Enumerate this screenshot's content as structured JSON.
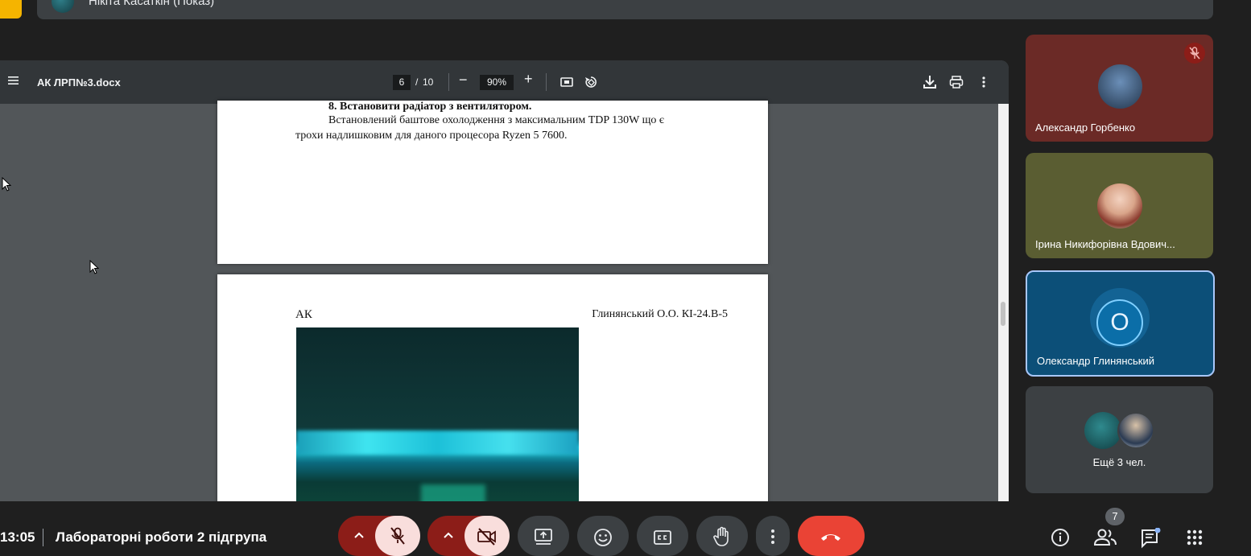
{
  "presenter": {
    "name": "Нікіта Касаткін (Показ)"
  },
  "viewer": {
    "doc_title": "АК ЛРП№3.docx",
    "current_page": "6",
    "page_separator": "/",
    "total_pages": "10",
    "zoom": "90%",
    "zoom_minus": "−",
    "zoom_plus": "+",
    "page1": {
      "heading": "8. Встановити радіатор з вентилятором.",
      "line1": "Встановлений баштове охолодження з максимальним TDP 130W що є",
      "line2": "трохи надлишковим для даного процесора Ryzen 5 7600."
    },
    "page2": {
      "header_left": "АК",
      "header_right": "Глинянський О.О. КІ-24.В-5"
    }
  },
  "participants": [
    {
      "name": "Александр Горбенко",
      "color": "#6b2a26",
      "muted": true
    },
    {
      "name": "Ірина Никифорівна Вдович...",
      "color": "#5a5d32"
    },
    {
      "name": "Олександр Глинянський",
      "initial": "О",
      "color": "#0c4f78",
      "active": true
    },
    {
      "name": "Ещё 3 чел."
    }
  ],
  "bottom_bar": {
    "time": "13:05",
    "meeting_title": "Лабораторні роботи 2 підгрупа",
    "people_count": "7"
  },
  "colors": {
    "end_call": "#ea4335",
    "mic_off_bg": "#f9dedc",
    "mic_off_dark": "#8c1d18",
    "active_border": "#a8c7fa"
  },
  "icons": [
    "menu-icon",
    "fit-page-icon",
    "rotate-icon",
    "download-icon",
    "print-icon",
    "more-vert-icon",
    "mic-off-icon",
    "camera-off-icon",
    "present-icon",
    "emoji-icon",
    "captions-icon",
    "raise-hand-icon",
    "more-vert-icon",
    "end-call-icon",
    "info-icon",
    "people-icon",
    "chat-icon",
    "apps-grid-icon"
  ]
}
